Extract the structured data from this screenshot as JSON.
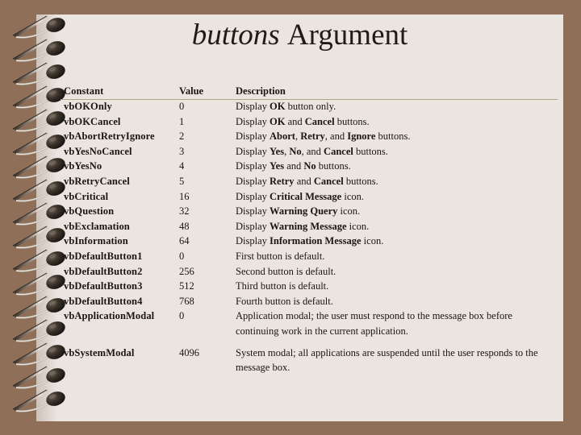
{
  "slide": {
    "title_italic": "buttons",
    "title_regular": "Argument",
    "page_bg": "#eae5e1",
    "margin_bg": "#8f6f58",
    "rule_color": "#b4a585",
    "text_color": "#1c1510"
  },
  "table": {
    "headers": {
      "constant": "Constant",
      "value": "Value",
      "description": "Description"
    },
    "rows": [
      {
        "constant": "vbOKOnly",
        "value": "0",
        "desc_parts": [
          {
            "t": "Display ",
            "b": false
          },
          {
            "t": "OK",
            "b": true
          },
          {
            "t": " button only.",
            "b": false
          }
        ]
      },
      {
        "constant": "vbOKCancel",
        "value": "1",
        "desc_parts": [
          {
            "t": "Display ",
            "b": false
          },
          {
            "t": "OK",
            "b": true
          },
          {
            "t": " and ",
            "b": false
          },
          {
            "t": "Cancel",
            "b": true
          },
          {
            "t": " buttons.",
            "b": false
          }
        ]
      },
      {
        "constant": "vbAbortRetryIgnore",
        "value": "2",
        "desc_parts": [
          {
            "t": "Display ",
            "b": false
          },
          {
            "t": "Abort",
            "b": true
          },
          {
            "t": ", ",
            "b": false
          },
          {
            "t": "Retry",
            "b": true
          },
          {
            "t": ", and ",
            "b": false
          },
          {
            "t": "Ignore",
            "b": true
          },
          {
            "t": " buttons.",
            "b": false
          }
        ]
      },
      {
        "constant": "vbYesNoCancel",
        "value": "3",
        "desc_parts": [
          {
            "t": "Display ",
            "b": false
          },
          {
            "t": "Yes",
            "b": true
          },
          {
            "t": ", ",
            "b": false
          },
          {
            "t": "No",
            "b": true
          },
          {
            "t": ", and ",
            "b": false
          },
          {
            "t": "Cancel",
            "b": true
          },
          {
            "t": " buttons.",
            "b": false
          }
        ]
      },
      {
        "constant": "vbYesNo",
        "value": "4",
        "desc_parts": [
          {
            "t": "Display ",
            "b": false
          },
          {
            "t": "Yes",
            "b": true
          },
          {
            "t": " and ",
            "b": false
          },
          {
            "t": "No",
            "b": true
          },
          {
            "t": " buttons.",
            "b": false
          }
        ]
      },
      {
        "constant": "vbRetryCancel",
        "value": "5",
        "desc_parts": [
          {
            "t": "Display ",
            "b": false
          },
          {
            "t": "Retry",
            "b": true
          },
          {
            "t": " and ",
            "b": false
          },
          {
            "t": "Cancel",
            "b": true
          },
          {
            "t": " buttons.",
            "b": false
          }
        ]
      },
      {
        "constant": "vbCritical",
        "value": "16",
        "desc_parts": [
          {
            "t": "Display ",
            "b": false
          },
          {
            "t": "Critical Message",
            "b": true
          },
          {
            "t": " icon.",
            "b": false
          }
        ]
      },
      {
        "constant": "vbQuestion",
        "value": "32",
        "desc_parts": [
          {
            "t": "Display ",
            "b": false
          },
          {
            "t": "Warning Query",
            "b": true
          },
          {
            "t": " icon.",
            "b": false
          }
        ]
      },
      {
        "constant": "vbExclamation",
        "value": "48",
        "desc_parts": [
          {
            "t": "Display ",
            "b": false
          },
          {
            "t": "Warning Message",
            "b": true
          },
          {
            "t": " icon.",
            "b": false
          }
        ]
      },
      {
        "constant": "vbInformation",
        "value": "64",
        "desc_parts": [
          {
            "t": "Display ",
            "b": false
          },
          {
            "t": "Information Message",
            "b": true
          },
          {
            "t": " icon.",
            "b": false
          }
        ]
      },
      {
        "constant": "vbDefaultButton1",
        "value": "0",
        "desc_parts": [
          {
            "t": "First button is default.",
            "b": false
          }
        ]
      },
      {
        "constant": "vbDefaultButton2",
        "value": "256",
        "desc_parts": [
          {
            "t": "Second button is default.",
            "b": false
          }
        ]
      },
      {
        "constant": "vbDefaultButton3",
        "value": "512",
        "desc_parts": [
          {
            "t": "Third button is default.",
            "b": false
          }
        ]
      },
      {
        "constant": "vbDefaultButton4",
        "value": "768",
        "desc_parts": [
          {
            "t": "Fourth button is default.",
            "b": false
          }
        ]
      },
      {
        "constant": "vbApplicationModal",
        "value": "0",
        "desc_parts": [
          {
            "t": "Application modal; the user must respond to the message box before continuing work in the current application.",
            "b": false
          }
        ]
      },
      {
        "constant": "vbSystemModal",
        "value": "4096",
        "desc_parts": [
          {
            "t": "System modal; all applications are suspended until the user responds to the message box.",
            "b": false
          }
        ]
      }
    ]
  }
}
